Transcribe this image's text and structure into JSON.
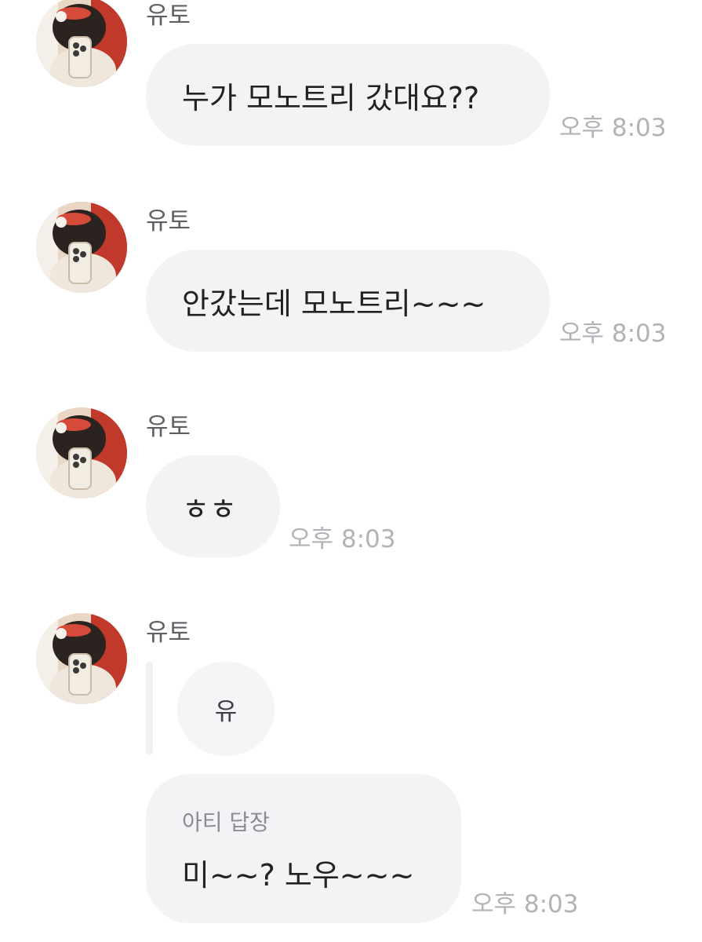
{
  "messages": [
    {
      "sender": "유토",
      "avatar_icon": "profile-avatar",
      "text": "누가 모노트리 갔대요??",
      "time": "오후 8:03"
    },
    {
      "sender": "유토",
      "avatar_icon": "profile-avatar",
      "text": "안갔는데 모노트리~~~",
      "time": "오후 8:03"
    },
    {
      "sender": "유토",
      "avatar_icon": "profile-avatar",
      "text": "ㅎㅎ",
      "time": "오후 8:03"
    },
    {
      "sender": "유토",
      "avatar_icon": "profile-avatar",
      "quoted_text": "유",
      "reply_label": "아티 답장",
      "text": "미~~? 노우~~~",
      "time": "오후 8:03"
    }
  ],
  "colors": {
    "bubble": "#f3f3f6",
    "text": "#222222",
    "time": "#b2b2b8",
    "sender": "#5f5f66"
  }
}
